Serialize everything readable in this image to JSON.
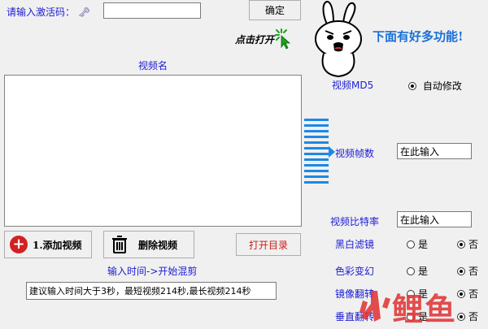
{
  "activation": {
    "label": "请输入激活码：",
    "code_value": "",
    "confirm_label": "确定"
  },
  "promo": {
    "click_text": "点击打开",
    "banner_text": "下面有好多功能!"
  },
  "video_list": {
    "label": "视频名"
  },
  "buttons": {
    "add_video": "1.添加视频",
    "delete_video": "删除视频",
    "open_dir": "打开目录"
  },
  "time": {
    "label": "输入时间->开始混剪",
    "hint_value": "建议输入时间大于3秒，最短视频214秒,最长视频214秒"
  },
  "settings": {
    "md5_label": "视频MD5",
    "md5_option": "自动修改",
    "fps_label": "视频帧数",
    "fps_value": "在此输入",
    "bitrate_label": "视频比特率",
    "bitrate_value": "在此输入",
    "rows": [
      {
        "label": "黑白滤镜",
        "yes": "是",
        "no": "否",
        "selected": "no"
      },
      {
        "label": "色彩变幻",
        "yes": "是",
        "no": "否",
        "selected": "no"
      },
      {
        "label": "镜像翻转",
        "yes": "是",
        "no": "否",
        "selected": "no"
      },
      {
        "label": "垂直翻转",
        "yes": "是",
        "no": "否",
        "selected": "no"
      }
    ]
  },
  "watermark": {
    "text": "鲤鱼"
  },
  "colors": {
    "label_blue": "#1c1cd6",
    "banner_blue": "#1a6fd6",
    "arrow_blue": "#1e88e5",
    "click_green": "#1aa31a",
    "add_red": "#d32020",
    "open_red": "#cc1c1c",
    "watermark_red": "#e03030"
  }
}
